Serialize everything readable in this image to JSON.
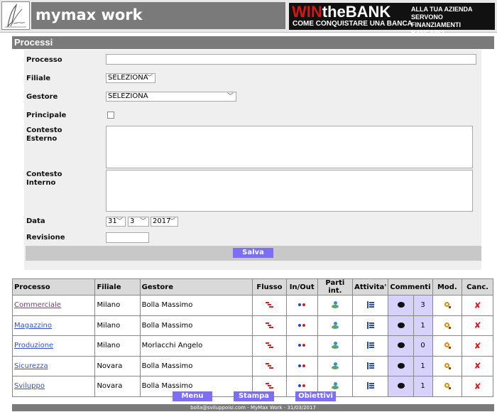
{
  "header": {
    "app_title": "mymax work",
    "banner": {
      "win": "WIN",
      "the_bank": "theBANK",
      "subtitle": "COME CONQUISTARE UNA BANCA",
      "right_text": "ALLA TUA AZIENDA SERVONO FINANZIAMENTI BANCARI?"
    }
  },
  "form": {
    "section_title": "Processi",
    "labels": {
      "processo": "Processo",
      "filiale": "Filiale",
      "gestore": "Gestore",
      "principale": "Principale",
      "contesto_esterno_1": "Contesto",
      "contesto_esterno_2": "Esterno",
      "contesto_interno_1": "Contesto",
      "contesto_interno_2": "Interno",
      "data": "Data",
      "revisione": "Revisione"
    },
    "values": {
      "processo": "",
      "filiale": "SELEZIONA",
      "gestore": "SELEZIONA",
      "principale_checked": false,
      "day": "31",
      "month": "3",
      "year": "2017",
      "revisione": ""
    },
    "save_label": "Salva"
  },
  "table": {
    "headers": [
      "Processo",
      "Filiale",
      "Gestore",
      "Flusso",
      "In/Out",
      "Parti int.",
      "Attivita'",
      "Commenti",
      "Mod.",
      "Canc."
    ],
    "rows": [
      {
        "processo": "Commerciale",
        "filiale": "Milano",
        "gestore": "Bolla Massimo",
        "commenti": "3"
      },
      {
        "processo": "Magazzino",
        "filiale": "Milano",
        "gestore": "Bolla Massimo",
        "commenti": "1"
      },
      {
        "processo": "Produzione",
        "filiale": "Milano",
        "gestore": "Morlacchi Angelo",
        "commenti": "0"
      },
      {
        "processo": "Sicurezza",
        "filiale": "Novara",
        "gestore": "Bolla Massimo",
        "commenti": "1"
      },
      {
        "processo": "Sviluppo",
        "filiale": "Novara",
        "gestore": "Bolla Massimo",
        "commenti": "1"
      }
    ],
    "icons": {
      "flusso": "flow-icon",
      "inout": "in-out-icon",
      "parti": "people-icon",
      "attivita": "activity-list-icon",
      "commenti": "comment-icon",
      "mod": "edit-magnifier-icon",
      "canc": "delete-x-icon"
    },
    "delete_glyph": "✘"
  },
  "buttons": {
    "menu": "Menu",
    "stampa": "Stampa",
    "obiettivi": "Obiettivi"
  },
  "footer": {
    "text": "bolla@sviluppoisi.com - MyMax Work - 31/03/2017"
  },
  "colors": {
    "bar_gray": "#7a7a7a",
    "button_purple": "#7c6ff5",
    "comment_cell": "#d7d2fb",
    "delete_red": "#e01818"
  }
}
